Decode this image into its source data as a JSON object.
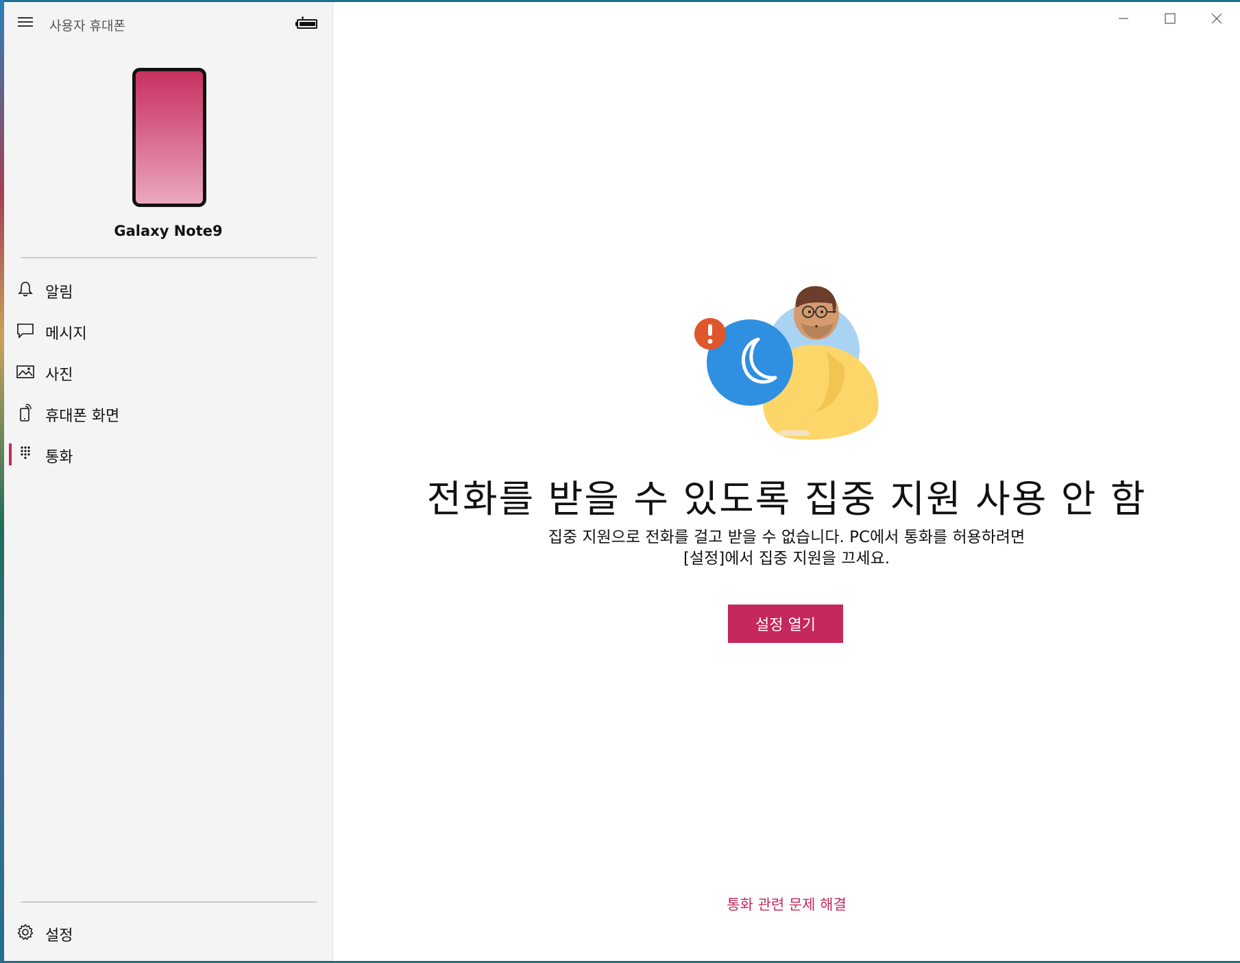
{
  "app": {
    "title": "사용자 휴대폰",
    "device_name": "Galaxy Note9"
  },
  "nav": {
    "items": [
      {
        "label": "알림",
        "icon": "bell-icon"
      },
      {
        "label": "메시지",
        "icon": "message-icon"
      },
      {
        "label": "사진",
        "icon": "photo-icon"
      },
      {
        "label": "휴대폰 화면",
        "icon": "phone-screen-icon"
      },
      {
        "label": "통화",
        "icon": "dialpad-icon",
        "active": true
      }
    ],
    "settings_label": "설정"
  },
  "main": {
    "headline": "전화를 받을 수 있도록 집중 지원 사용 안 함",
    "desc_line1": "집중 지원으로 전화를 걸고 받을 수 없습니다. PC에서 통화를 허용하려면",
    "desc_line2": "[설정]에서 집중 지원을 끄세요.",
    "button_label": "설정 열기",
    "link_label": "통화 관련 문제 해결"
  },
  "colors": {
    "accent": "#c5285c",
    "sidebar_bg": "#f4f4f4",
    "moon_blue": "#2f8fe0",
    "alert_orange": "#e0572c"
  }
}
